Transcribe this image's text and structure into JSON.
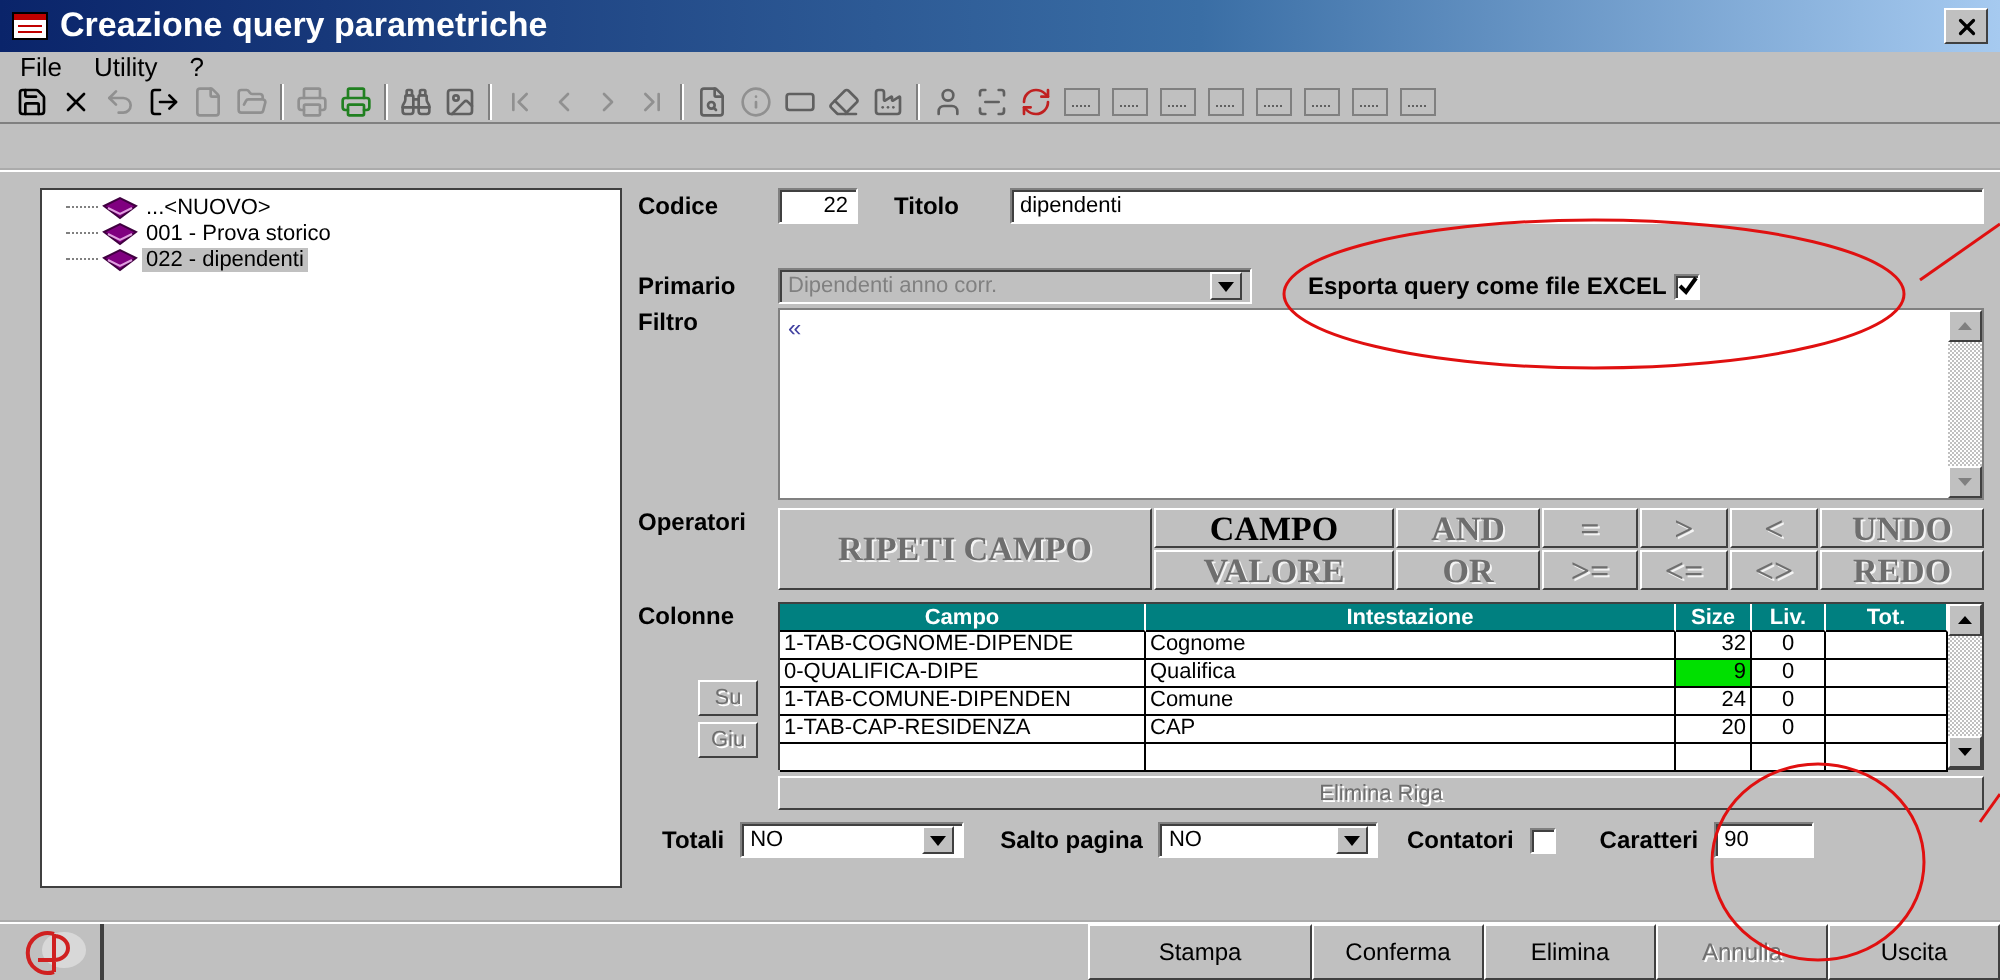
{
  "window": {
    "title": "Creazione query parametriche"
  },
  "menu": [
    "File",
    "Utility",
    "?"
  ],
  "tree": {
    "items": [
      {
        "label": "...<NUOVO>",
        "selected": false
      },
      {
        "label": "001 - Prova storico",
        "selected": false
      },
      {
        "label": "022 - dipendenti",
        "selected": true
      }
    ]
  },
  "form": {
    "codice": {
      "label": "Codice",
      "value": "22"
    },
    "titolo": {
      "label": "Titolo",
      "value": "dipendenti"
    },
    "primario": {
      "label": "Primario",
      "value": "Dipendenti anno corr.",
      "disabled": true
    },
    "esporta": {
      "label": "Esporta query come file EXCEL",
      "checked": true
    },
    "filtro": {
      "label": "Filtro",
      "value": "«"
    },
    "operatori": {
      "label": "Operatori",
      "buttons": [
        {
          "label": "RIPETI CAMPO",
          "disabled": true
        },
        {
          "label": "CAMPO",
          "disabled": false
        },
        {
          "label": "VALORE",
          "disabled": true
        },
        {
          "label": "AND",
          "disabled": true
        },
        {
          "label": "OR",
          "disabled": true
        },
        {
          "label": "=",
          "disabled": true
        },
        {
          "label": ">=",
          "disabled": true
        },
        {
          "label": ">",
          "disabled": true
        },
        {
          "label": "<=",
          "disabled": true
        },
        {
          "label": "<",
          "disabled": true
        },
        {
          "label": "<>",
          "disabled": true
        },
        {
          "label": "UNDO",
          "disabled": true
        },
        {
          "label": "REDO",
          "disabled": true
        }
      ]
    },
    "colonne": {
      "label": "Colonne",
      "move_buttons": [
        {
          "label": "Su",
          "disabled": true
        },
        {
          "label": "Giu",
          "disabled": true
        }
      ],
      "columns": [
        "Campo",
        "Intestazione",
        "Size",
        "Liv.",
        "Tot."
      ],
      "rows": [
        {
          "campo": "1-TAB-COGNOME-DIPENDE",
          "intestazione": "Cognome",
          "size": "32",
          "liv": "0",
          "size_highlighted": false
        },
        {
          "campo": "0-QUALIFICA-DIPE",
          "intestazione": "Qualifica",
          "size": "9",
          "liv": "0",
          "size_highlighted": true
        },
        {
          "campo": "1-TAB-COMUNE-DIPENDEN",
          "intestazione": "Comune",
          "size": "24",
          "liv": "0",
          "size_highlighted": false
        },
        {
          "campo": "1-TAB-CAP-RESIDENZA",
          "intestazione": "CAP",
          "size": "20",
          "liv": "0",
          "size_highlighted": false
        }
      ],
      "delete_button": {
        "label": "Elimina Riga",
        "disabled": true
      }
    },
    "totali": {
      "label": "Totali",
      "value": "NO"
    },
    "salto_pagina": {
      "label": "Salto pagina",
      "value": "NO"
    },
    "contatori": {
      "label": "Contatori",
      "checked": false
    },
    "caratteri": {
      "label": "Caratteri",
      "value": "90"
    }
  },
  "footer_buttons": [
    {
      "label": "Stampa",
      "disabled": false
    },
    {
      "label": "Conferma",
      "disabled": false
    },
    {
      "label": "Elimina",
      "disabled": false
    },
    {
      "label": "Annulla",
      "disabled": true
    },
    {
      "label": "Uscita",
      "disabled": false
    }
  ]
}
